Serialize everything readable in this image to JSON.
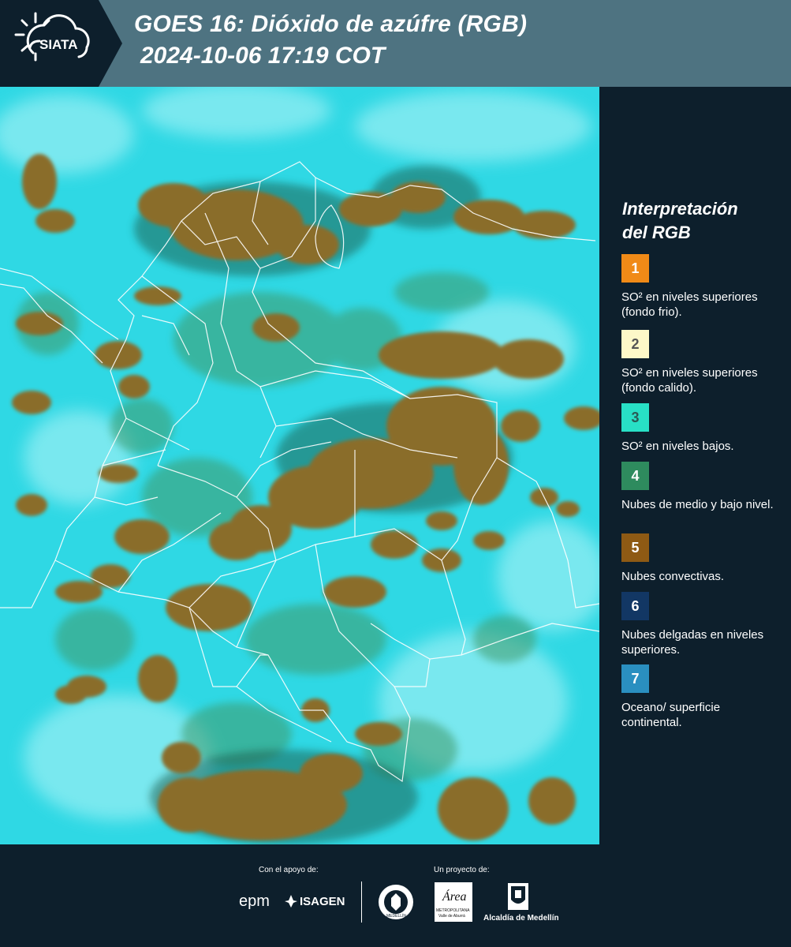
{
  "header": {
    "logo_text": "SIATA",
    "title_line1": "GOES 16: Dióxido de azúfre (RGB)",
    "title_line2": "2024-10-06 17:19 COT"
  },
  "legend": {
    "title_line1": "Interpretación",
    "title_line2": "del RGB",
    "items": [
      {
        "num": "1",
        "color": "#f08a17",
        "num_color": "#ffffff",
        "label": "SO² en niveles superiores (fondo frio)."
      },
      {
        "num": "2",
        "color": "#fdf8c8",
        "num_color": "#555555",
        "label": "SO² en niveles superiores (fondo calido)."
      },
      {
        "num": "3",
        "color": "#28e0c6",
        "num_color": "#2a5a55",
        "label": "SO² en niveles bajos."
      },
      {
        "num": "4",
        "color": "#2e8b5e",
        "num_color": "#ffffff",
        "label": "Nubes de medio y bajo nivel."
      },
      {
        "num": "5",
        "color": "#8e5a14",
        "num_color": "#ffffff",
        "label": "Nubes convectivas."
      },
      {
        "num": "6",
        "color": "#123764",
        "num_color": "#ffffff",
        "label": "Nubes delgadas en niveles superiores."
      },
      {
        "num": "7",
        "color": "#2a8fc0",
        "num_color": "#ffffff",
        "label": "Oceano/ superficie continental."
      }
    ]
  },
  "map": {
    "colors": {
      "background": "#2fd8e4",
      "cloud": "#8a6d2c",
      "green": "#3f9a6a",
      "boundary": "#ffffff"
    }
  },
  "footer": {
    "support_label": "Con el apoyo de:",
    "project_label": "Un proyecto de:",
    "epm": "epm",
    "isagen": "ISAGEN",
    "area_name": "Área",
    "area_sub": "METROPOLITANA",
    "area_sub2": "Valle de Aburrá",
    "alcaldia": "Alcaldía de Medellín",
    "medellin_seal": "MEDELLÍN"
  }
}
